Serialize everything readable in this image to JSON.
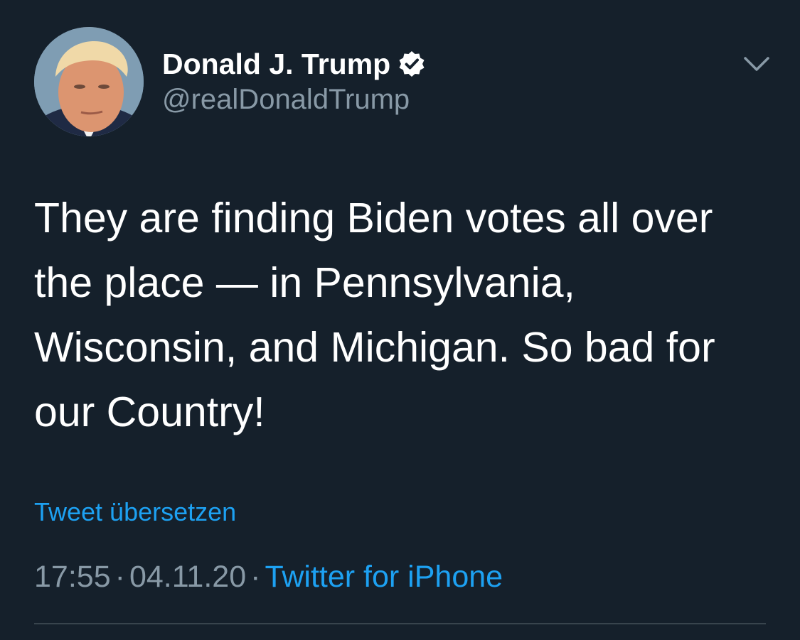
{
  "author": {
    "display_name": "Donald J. Trump",
    "handle": "@realDonaldTrump",
    "verified": true
  },
  "tweet": {
    "text": "They are finding Biden votes all over\nthe place — in Pennsylvania,\nWisconsin, and Michigan. So bad for\nour Country!",
    "translate_label": "Tweet übersetzen",
    "time": "17:55",
    "date": "04.11.20",
    "separator": "·",
    "source": "Twitter for iPhone"
  },
  "icons": {
    "menu": "chevron-down-icon",
    "verified": "verified-badge-icon"
  },
  "colors": {
    "background": "#15202b",
    "text": "#ffffff",
    "secondary_text": "#8899a6",
    "link": "#1da1f2",
    "divider": "#38444d"
  }
}
